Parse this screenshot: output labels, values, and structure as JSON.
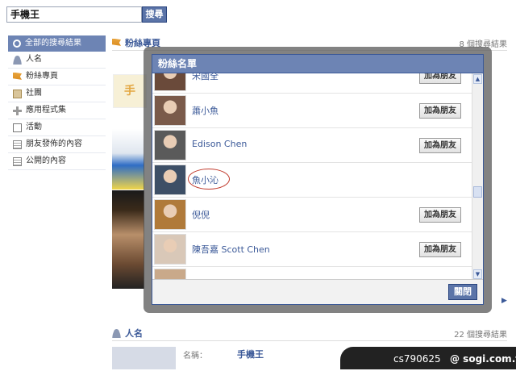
{
  "search": {
    "query": "手機王",
    "button_label": "搜尋"
  },
  "sidebar": {
    "items": [
      {
        "label": "全部的搜尋結果",
        "icon": "search-icon",
        "active": true
      },
      {
        "label": "人名",
        "icon": "person-icon"
      },
      {
        "label": "粉絲專頁",
        "icon": "flag-icon"
      },
      {
        "label": "社團",
        "icon": "group-icon"
      },
      {
        "label": "應用程式集",
        "icon": "apps-icon"
      },
      {
        "label": "活動",
        "icon": "calendar-icon"
      },
      {
        "label": "朋友發佈的內容",
        "icon": "friends-posts-icon"
      },
      {
        "label": "公開的內容",
        "icon": "public-posts-icon"
      }
    ]
  },
  "pages_section": {
    "title": "粉絲專頁",
    "count": "8 個搜尋結果"
  },
  "people_section": {
    "title": "人名",
    "count": "22 個搜尋結果",
    "name_label": "名稱：",
    "name_value": "手機王"
  },
  "dialog": {
    "title": "粉絲名單",
    "close_label": "關閉",
    "fans": [
      {
        "name": "宋國全",
        "button": "加為朋友",
        "avatar": "#6a4a3a"
      },
      {
        "name": "蕭小魚",
        "button": "加為朋友",
        "avatar": "#7a5a4a"
      },
      {
        "name": "Edison Chen",
        "button": "加為朋友",
        "avatar": "#5a5a5a"
      },
      {
        "name": "魚小沁",
        "button": "",
        "avatar": "#3d4f66",
        "highlighted": true
      },
      {
        "name": "倪倪",
        "button": "加為朋友",
        "avatar": "#b07a3a"
      },
      {
        "name": "陳吾嘉 Scott Chen",
        "button": "加為朋友",
        "avatar": "#d9c8b8"
      }
    ]
  },
  "watermark": {
    "id": "cs790625",
    "site": "@ sogi.com.tw"
  },
  "colors": {
    "brand": "#3b5998",
    "header": "#6d84b4",
    "accent_circle": "#c0392b"
  }
}
